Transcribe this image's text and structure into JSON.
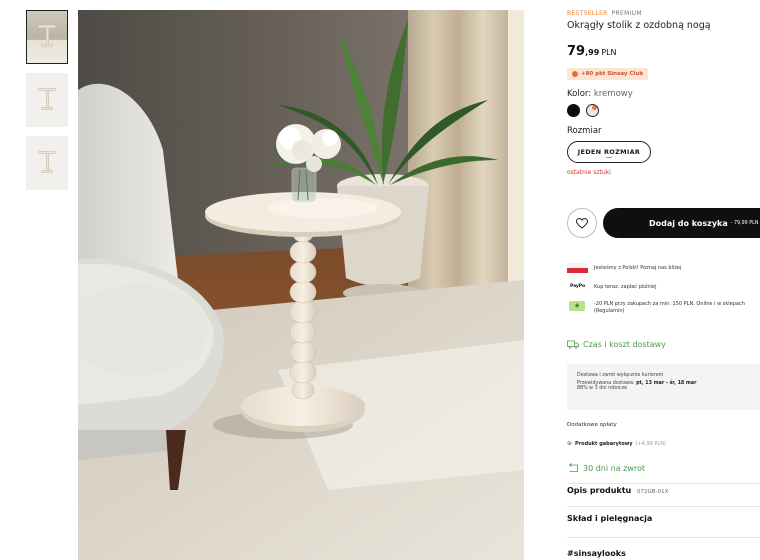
{
  "product": {
    "tags": {
      "bestseller": "BESTSELLER",
      "premium": "PREMIUM"
    },
    "title": "Okrągły stolik z ozdobną nogą",
    "price": {
      "integer": "79",
      "decimal": ",99",
      "currency": "PLN"
    },
    "club_badge": "+80 pkt Sinsay Club",
    "color": {
      "label": "Kolor:",
      "value": "kremowy"
    },
    "size": {
      "label": "Rozmiar",
      "option": "JEDEN ROZMIAR"
    },
    "stock_note": "ostatnie sztuki",
    "add_to_cart": {
      "label": "Dodaj do koszyka",
      "price": "- 79,99 PLN"
    }
  },
  "perks": [
    {
      "icon": "polish-flag-icon",
      "text": "Jesteśmy z Polski! Poznaj nas bliżej"
    },
    {
      "icon": "paypo-icon",
      "badge": "PayPo",
      "text": "Kup teraz, zapłać później"
    },
    {
      "icon": "promo-tag-icon",
      "text": "-20 PLN przy zakupach za min. 150 PLN. Online i w sklepach",
      "text2": "(Regulamin)"
    }
  ],
  "delivery": {
    "link": "Czas i koszt dostawy",
    "line1": "Dostawa i zwrot wyłącznie kurierem",
    "line2_prefix": "Przewidywana dostawa:",
    "line2_dates": "pt, 13 mar - śr, 18 mar",
    "line3": "88% w 3 dni robocze"
  },
  "fees": {
    "label": "Dodatkowe opłaty",
    "item": "Produkt gabarytowy",
    "item_price": "(+4,99 PLN)"
  },
  "returns": {
    "link": "30 dni na zwrot"
  },
  "sections": {
    "description": "Opis produktu",
    "code": "072GB-01X",
    "care": "Skład i pielęgnacja",
    "looks": "#sinsaylooks"
  },
  "colors": {
    "accent_orange": "#f07d2a",
    "green_link": "#4a9a4a",
    "stock_red": "#d6342b",
    "button_black": "#0f0f0f"
  }
}
